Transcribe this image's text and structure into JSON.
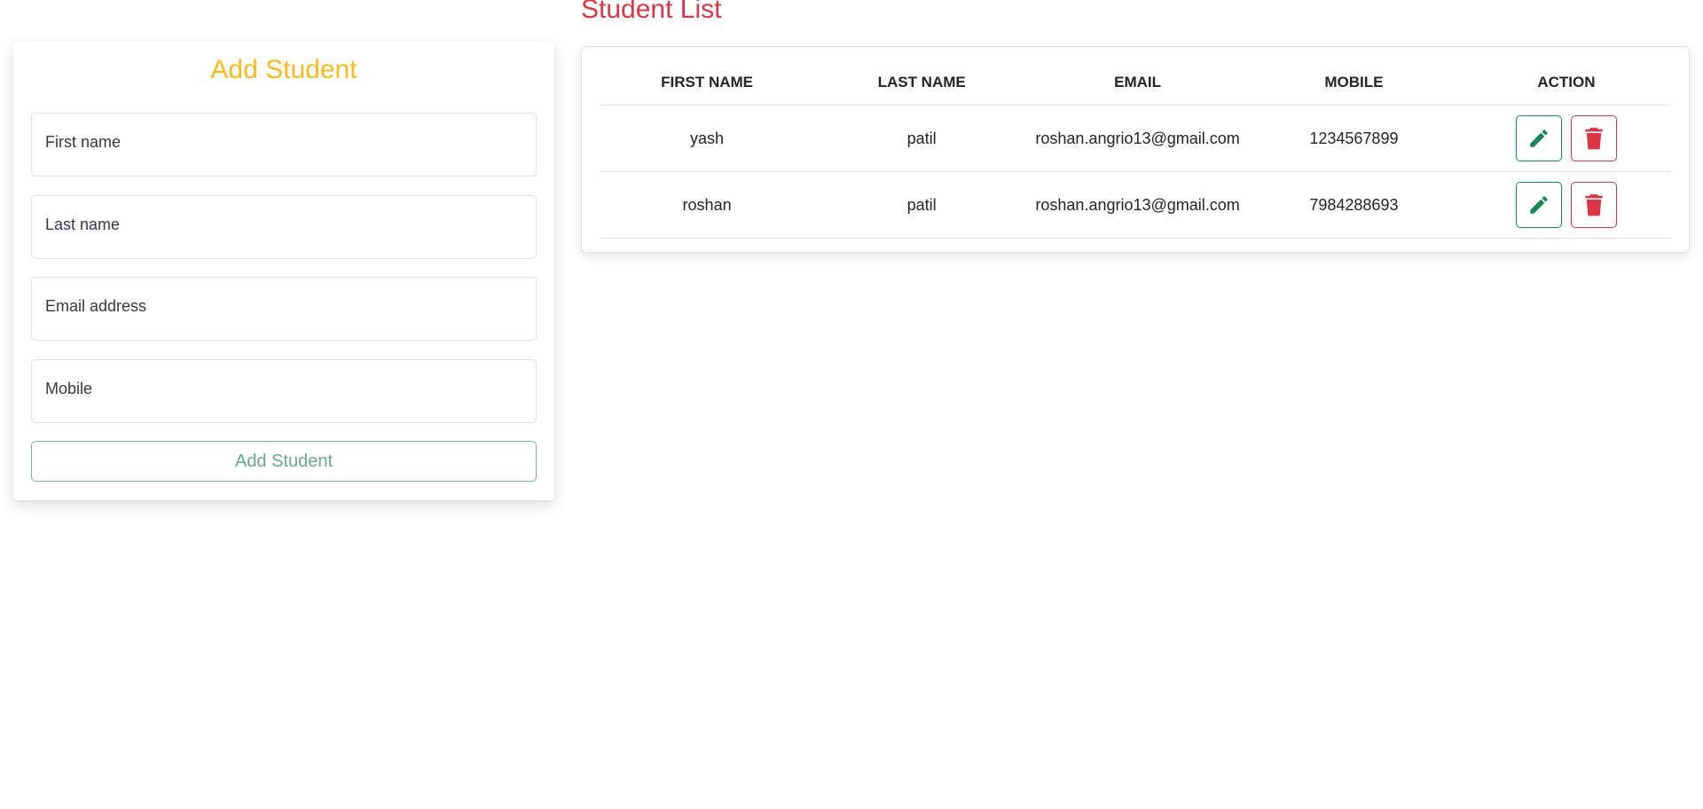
{
  "form": {
    "title": "Add Student",
    "fields": {
      "first_name": {
        "placeholder": "First name",
        "value": ""
      },
      "last_name": {
        "placeholder": "Last name",
        "value": ""
      },
      "email": {
        "placeholder": "Email address",
        "value": ""
      },
      "mobile": {
        "placeholder": "Mobile",
        "value": ""
      }
    },
    "submit_label": "Add Student"
  },
  "list": {
    "title": "Student List",
    "columns": [
      "FIRST NAME",
      "LAST NAME",
      "EMAIL",
      "MOBILE",
      "ACTION"
    ],
    "rows": [
      {
        "first_name": "yash",
        "last_name": "patil",
        "email": "roshan.angrio13@gmail.com",
        "mobile": "1234567899",
        "actions": [
          "pencil-icon",
          "trash-icon"
        ]
      },
      {
        "first_name": "roshan",
        "last_name": "patil",
        "email": "roshan.angrio13@gmail.com",
        "mobile": "7984288693",
        "actions": [
          "pencil-icon",
          "trash-icon"
        ]
      }
    ]
  },
  "colors": {
    "form_title": "#f5bc1c",
    "list_title": "#dc3545",
    "edit_accent": "#198754",
    "delete_accent": "#dc3545"
  }
}
